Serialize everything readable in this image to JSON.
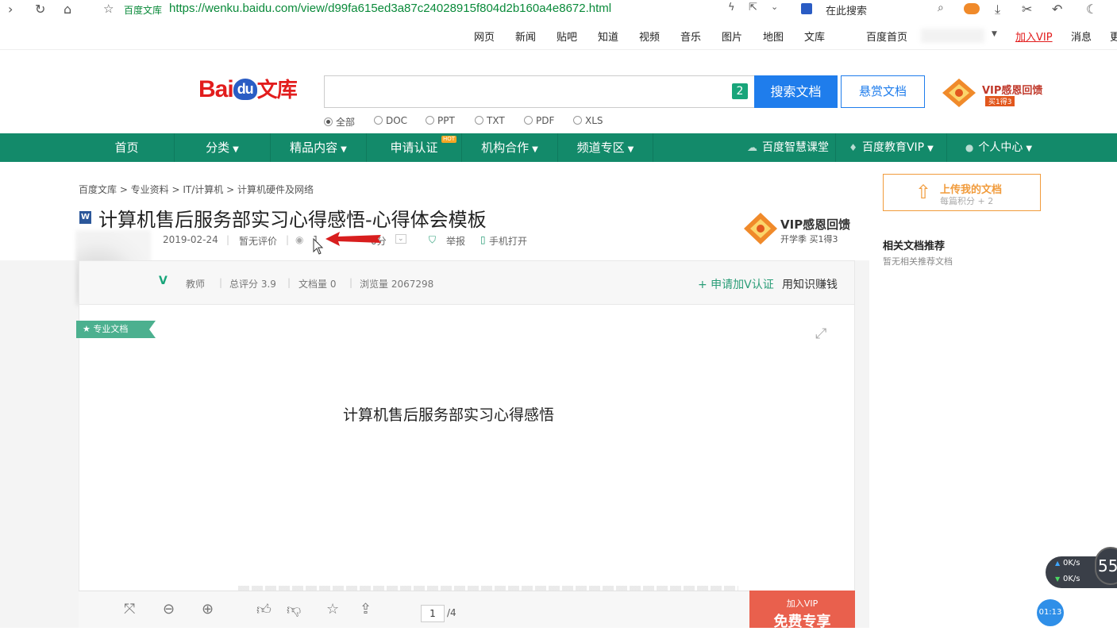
{
  "browser": {
    "site_name": "百度文库",
    "url": "https://wenku.baidu.com/view/d99fa615ed3a87c24028915f804d2b160a4e8672.html",
    "search_hint": "在此搜索"
  },
  "top_links": [
    "网页",
    "新闻",
    "贴吧",
    "知道",
    "视频",
    "音乐",
    "图片",
    "地图",
    "文库",
    "百度首页",
    "加入VIP",
    "消息",
    "更"
  ],
  "header": {
    "logo_text": "Bai",
    "logo_du": "du",
    "logo_wenku": "文库",
    "search_badge": "2",
    "search_button": "搜索文档",
    "reward_button": "悬赏文档",
    "vip_text": "VIP感恩回馈",
    "vip_sub": "买1得3",
    "filters": [
      "全部",
      "DOC",
      "PPT",
      "TXT",
      "PDF",
      "XLS"
    ]
  },
  "green_nav": {
    "items": [
      "首页",
      "分类",
      "精品内容",
      "申请认证",
      "机构合作",
      "频道专区"
    ],
    "hot": "HOT",
    "right": [
      "百度智慧课堂",
      "百度教育VIP",
      "个人中心"
    ]
  },
  "breadcrumb": "百度文库 > 专业资料 > IT/计算机 > 计算机硬件及网络",
  "doc": {
    "icon": "W",
    "title": "计算机售后服务部实习心得感悟-心得体会模板",
    "date": "2019-02-24",
    "rating": "暂无评价",
    "views_short": "1",
    "score_label": "0分",
    "report": "举报",
    "phone": "手机打开",
    "vip_text": "VIP感恩回馈",
    "vip_sub": "开学季 买1得3"
  },
  "author": {
    "role": "教师",
    "total_score": "总评分 3.9",
    "doc_count": "文档量 0",
    "view_count": "浏览量 2067298",
    "apply_v": "+ 申请加V认证",
    "earn": "用知识赚钱"
  },
  "page": {
    "tag": "专业文档",
    "heading": "计算机售后服务部实习心得感悟",
    "page_current": "1",
    "page_total": "/4",
    "vip_top": "加入VIP",
    "vip_bottom": "免费专享"
  },
  "sidebar": {
    "upload_title": "上传我的文档",
    "upload_sub": "每篇积分 + 2",
    "related_title": "相关文档推荐",
    "related_empty": "暂无相关推荐文档"
  },
  "widget": {
    "up": "0K/s",
    "down": "0K/s",
    "num": "55",
    "timer": "01:13"
  }
}
